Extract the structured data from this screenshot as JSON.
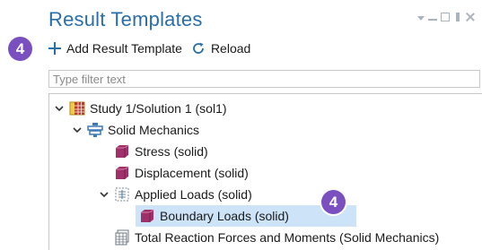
{
  "window": {
    "title": "Result Templates"
  },
  "badges": {
    "top": "4",
    "row": "4"
  },
  "toolbar": {
    "add_label": "Add Result Template",
    "reload_label": "Reload"
  },
  "filter": {
    "placeholder": "Type filter text",
    "value": ""
  },
  "tree": {
    "study": {
      "label": "Study 1/Solution 1 (sol1)",
      "icon": "study-grid-icon"
    },
    "solid": {
      "label": "Solid Mechanics",
      "icon": "physics-icon"
    },
    "stress": {
      "label": "Stress (solid)",
      "icon": "plot-group-icon"
    },
    "displacement": {
      "label": "Displacement (solid)",
      "icon": "plot-group-icon"
    },
    "applied": {
      "label": "Applied Loads (solid)",
      "icon": "load-group-icon"
    },
    "boundary": {
      "label": "Boundary Loads (solid)",
      "icon": "plot-group-icon"
    },
    "total": {
      "label": "Total Reaction Forces and Moments (Solid Mechanics)",
      "icon": "table-icon"
    }
  },
  "colors": {
    "title": "#2a6ea8",
    "badge": "#7a4fc0",
    "selection": "#cde3f7",
    "plot_icon": "#a0306a"
  }
}
